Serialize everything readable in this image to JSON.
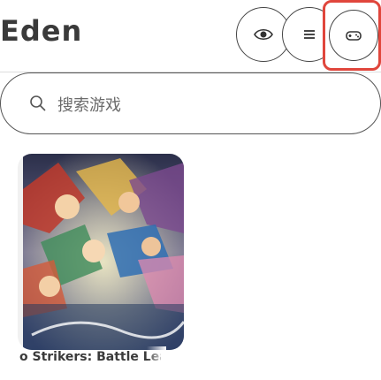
{
  "header": {
    "title": "Eden",
    "actions": [
      {
        "name": "eye-icon"
      },
      {
        "name": "menu-icon"
      },
      {
        "name": "gamepad-icon"
      }
    ],
    "highlight_color": "#e0463c"
  },
  "search": {
    "placeholder": "搜索游戏"
  },
  "games": [
    {
      "title": "o Strikers: Battle Lea"
    }
  ]
}
